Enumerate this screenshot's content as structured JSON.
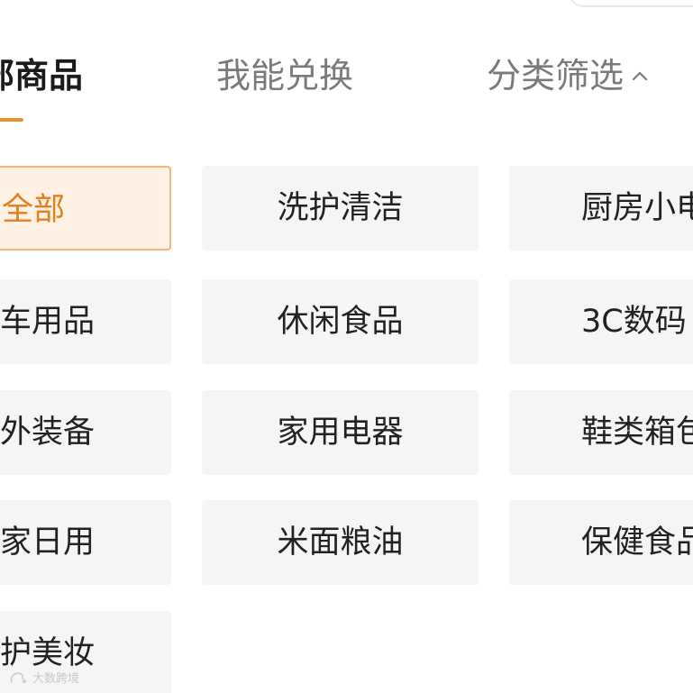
{
  "tabs": {
    "active_label": "部商品",
    "redeem_label": "我能兑换",
    "filter_label": "分类筛选"
  },
  "categories": [
    {
      "label": "全部",
      "selected": true
    },
    {
      "label": "洗护清洁",
      "selected": false
    },
    {
      "label": "厨房小电",
      "selected": false
    },
    {
      "label": "车用品",
      "selected": false
    },
    {
      "label": "休闲食品",
      "selected": false
    },
    {
      "label": "3C数码",
      "selected": false
    },
    {
      "label": "外装备",
      "selected": false
    },
    {
      "label": "家用电器",
      "selected": false
    },
    {
      "label": "鞋类箱包",
      "selected": false
    },
    {
      "label": "家日用",
      "selected": false
    },
    {
      "label": "米面粮油",
      "selected": false
    },
    {
      "label": "保健食品",
      "selected": false
    },
    {
      "label": "护美妆",
      "selected": false
    }
  ],
  "watermark": "大数跨境",
  "colors": {
    "accent": "#e8902e",
    "selected_text": "#e0801f",
    "selected_bg": "#fff1e4",
    "chip_bg": "#f5f5f5"
  },
  "icons": {
    "filter_toggle": "chevron-up-icon",
    "watermark_logo": "logo-icon"
  }
}
